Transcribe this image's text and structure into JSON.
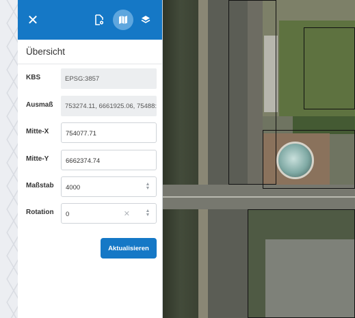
{
  "toolbar": {
    "close_icon": "close-icon",
    "icons": [
      "document-settings-icon",
      "map-icon",
      "layers-icon"
    ]
  },
  "section": {
    "title": "Übersicht"
  },
  "fields": {
    "kbs": {
      "label": "KBS",
      "value": "EPSG:3857"
    },
    "extent": {
      "label": "Ausmaß",
      "value": "753274.11, 6661925.06, 75488:"
    },
    "center_x": {
      "label": "Mitte-X",
      "value": "754077.71"
    },
    "center_y": {
      "label": "Mitte-Y",
      "value": "6662374.74"
    },
    "scale": {
      "label": "Maßstab",
      "value": "4000"
    },
    "rotation": {
      "label": "Rotation",
      "value": "0"
    }
  },
  "actions": {
    "update_label": "Aktualisieren"
  },
  "colors": {
    "accent": "#1578c6",
    "accent_light": "#5ea6de"
  }
}
